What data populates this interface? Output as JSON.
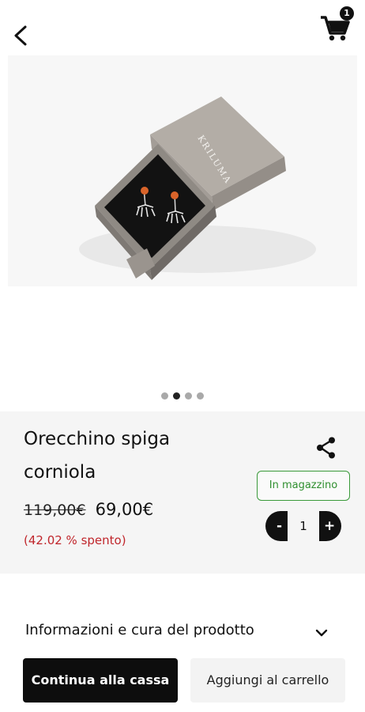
{
  "header": {
    "back_icon": "chevron-left-icon",
    "cart_icon": "shopping-cart-icon",
    "cart_count": "1"
  },
  "gallery": {
    "brand_logo_text": "KRILUMA",
    "slide_count": 4,
    "active_slide": 2
  },
  "product": {
    "title": "Orecchino spiga corniola",
    "share_icon": "share-icon",
    "stock_label": "In magazzino",
    "old_price": "119,00€",
    "price": "69,00€",
    "discount": "(42.02 % spento)",
    "quantity": "1",
    "minus_label": "-",
    "plus_label": "+"
  },
  "details": {
    "accordion_label": "Informazioni e cura del prodotto",
    "chevron_icon": "chevron-down-icon"
  },
  "actions": {
    "checkout_label": "Continua alla cassa",
    "add_to_cart_label": "Aggiungi al carrello"
  },
  "colors": {
    "stock_green": "#2f8f2f",
    "discount_red": "#c0262c",
    "primary_dark": "#0d0d0d"
  }
}
